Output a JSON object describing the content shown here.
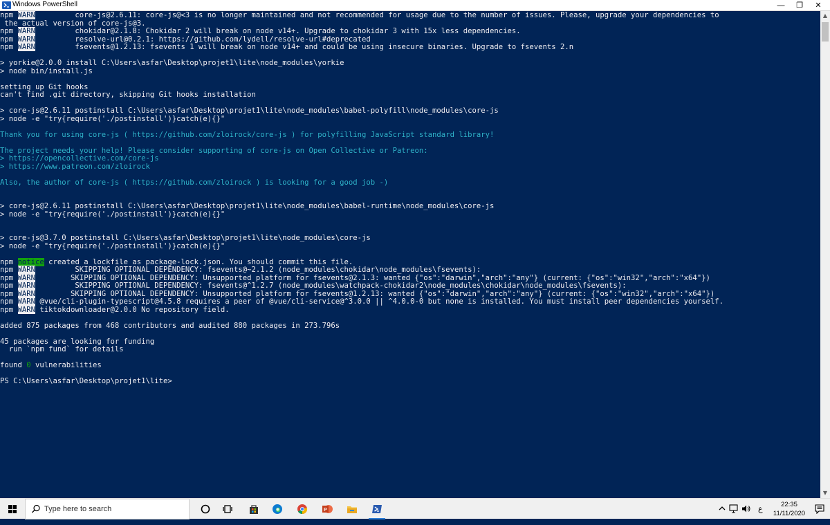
{
  "window": {
    "title": "Windows PowerShell",
    "minimize_glyph": "—",
    "restore_glyph": "❐",
    "close_glyph": "✕"
  },
  "console_lines": [
    {
      "segs": [
        {
          "t": "npm ",
          "c": "white"
        },
        {
          "t": "WARN",
          "c": "warn"
        },
        {
          "t": "         core-js@2.6.11: core-js@<3 is no longer maintained and not recommended for usage due to the number of issues. Please, upgrade your dependencies to",
          "c": "white"
        }
      ]
    },
    {
      "segs": [
        {
          "t": " the actual version of core-js@3.",
          "c": "white"
        }
      ]
    },
    {
      "segs": [
        {
          "t": "npm ",
          "c": "white"
        },
        {
          "t": "WARN",
          "c": "warn"
        },
        {
          "t": "         chokidar@2.1.8: Chokidar 2 will break on node v14+. Upgrade to chokidar 3 with 15x less dependencies.",
          "c": "white"
        }
      ]
    },
    {
      "segs": [
        {
          "t": "npm ",
          "c": "white"
        },
        {
          "t": "WARN",
          "c": "warn"
        },
        {
          "t": "         resolve-url@0.2.1: https://github.com/lydell/resolve-url#deprecated",
          "c": "white"
        }
      ]
    },
    {
      "segs": [
        {
          "t": "npm ",
          "c": "white"
        },
        {
          "t": "WARN",
          "c": "warn"
        },
        {
          "t": "         fsevents@1.2.13: fsevents 1 will break on node v14+ and could be using insecure binaries. Upgrade to fsevents 2.n",
          "c": "white"
        }
      ]
    },
    {
      "segs": []
    },
    {
      "segs": [
        {
          "t": "> yorkie@2.0.0 install C:\\Users\\asfar\\Desktop\\projet1\\lite\\node_modules\\yorkie",
          "c": "white"
        }
      ]
    },
    {
      "segs": [
        {
          "t": "> node bin/install.js",
          "c": "white"
        }
      ]
    },
    {
      "segs": []
    },
    {
      "segs": [
        {
          "t": "setting up Git hooks",
          "c": "white"
        }
      ]
    },
    {
      "segs": [
        {
          "t": "can't find .git directory, skipping Git hooks installation",
          "c": "white"
        }
      ]
    },
    {
      "segs": []
    },
    {
      "segs": [
        {
          "t": "> core-js@2.6.11 postinstall C:\\Users\\asfar\\Desktop\\projet1\\lite\\node_modules\\babel-polyfill\\node_modules\\core-js",
          "c": "white"
        }
      ]
    },
    {
      "segs": [
        {
          "t": "> node -e \"try{require('./postinstall')}catch(e){}\"",
          "c": "white"
        }
      ]
    },
    {
      "segs": []
    },
    {
      "segs": [
        {
          "t": "Thank you for using core-js ( ",
          "c": "cyan"
        },
        {
          "t": "https://github.com/zloirock/core-js",
          "c": "cyan"
        },
        {
          "t": " ) for polyfilling JavaScript standard library!",
          "c": "cyan"
        }
      ]
    },
    {
      "segs": []
    },
    {
      "segs": [
        {
          "t": "The project needs your help! Please consider supporting of core-js on Open Collective or Patreon:",
          "c": "cyan"
        }
      ]
    },
    {
      "segs": [
        {
          "t": "> ",
          "c": "cyan"
        },
        {
          "t": "https://opencollective.com/core-js",
          "c": "cyan"
        }
      ]
    },
    {
      "segs": [
        {
          "t": "> ",
          "c": "cyan"
        },
        {
          "t": "https://www.patreon.com/zloirock",
          "c": "cyan"
        }
      ]
    },
    {
      "segs": []
    },
    {
      "segs": [
        {
          "t": "Also, the author of core-js ( ",
          "c": "cyan"
        },
        {
          "t": "https://github.com/zloirock",
          "c": "cyan"
        },
        {
          "t": " ) is looking for a good job -)",
          "c": "cyan"
        }
      ]
    },
    {
      "segs": []
    },
    {
      "segs": []
    },
    {
      "segs": [
        {
          "t": "> core-js@2.6.11 postinstall C:\\Users\\asfar\\Desktop\\projet1\\lite\\node_modules\\babel-runtime\\node_modules\\core-js",
          "c": "white"
        }
      ]
    },
    {
      "segs": [
        {
          "t": "> node -e \"try{require('./postinstall')}catch(e){}\"",
          "c": "white"
        }
      ]
    },
    {
      "segs": []
    },
    {
      "segs": []
    },
    {
      "segs": [
        {
          "t": "> core-js@3.7.0 postinstall C:\\Users\\asfar\\Desktop\\projet1\\lite\\node_modules\\core-js",
          "c": "white"
        }
      ]
    },
    {
      "segs": [
        {
          "t": "> node -e \"try{require('./postinstall')}catch(e){}\"",
          "c": "white"
        }
      ]
    },
    {
      "segs": []
    },
    {
      "segs": [
        {
          "t": "npm ",
          "c": "white"
        },
        {
          "t": "notice",
          "c": "notice"
        },
        {
          "t": " created a lockfile as package-lock.json. You should commit this file.",
          "c": "white"
        }
      ]
    },
    {
      "segs": [
        {
          "t": "npm ",
          "c": "white"
        },
        {
          "t": "WARN",
          "c": "warn"
        },
        {
          "t": "         SKIPPING OPTIONAL DEPENDENCY: fsevents@~2.1.2 (node_modules\\chokidar\\node_modules\\fsevents):",
          "c": "white"
        }
      ]
    },
    {
      "segs": [
        {
          "t": "npm ",
          "c": "white"
        },
        {
          "t": "WARN",
          "c": "warn"
        },
        {
          "t": "        SKIPPING OPTIONAL DEPENDENCY: Unsupported platform for fsevents@2.1.3: wanted {\"os\":\"darwin\",\"arch\":\"any\"} (current: {\"os\":\"win32\",\"arch\":\"x64\"})",
          "c": "white"
        }
      ]
    },
    {
      "segs": [
        {
          "t": "npm ",
          "c": "white"
        },
        {
          "t": "WARN",
          "c": "warn"
        },
        {
          "t": "         SKIPPING OPTIONAL DEPENDENCY: fsevents@^1.2.7 (node_modules\\watchpack-chokidar2\\node_modules\\chokidar\\node_modules\\fsevents):",
          "c": "white"
        }
      ]
    },
    {
      "segs": [
        {
          "t": "npm ",
          "c": "white"
        },
        {
          "t": "WARN",
          "c": "warn"
        },
        {
          "t": "        SKIPPING OPTIONAL DEPENDENCY: Unsupported platform for fsevents@1.2.13: wanted {\"os\":\"darwin\",\"arch\":\"any\"} (current: {\"os\":\"win32\",\"arch\":\"x64\"})",
          "c": "white"
        }
      ]
    },
    {
      "segs": [
        {
          "t": "npm ",
          "c": "white"
        },
        {
          "t": "WARN",
          "c": "warn"
        },
        {
          "t": " @vue/cli-plugin-typescript@4.5.8 requires a peer of @vue/cli-service@^3.0.0 || ^4.0.0-0 but none is installed. You must install peer dependencies yourself.",
          "c": "white"
        }
      ]
    },
    {
      "segs": [
        {
          "t": "npm ",
          "c": "white"
        },
        {
          "t": "WARN",
          "c": "warn"
        },
        {
          "t": " tiktokdownloader@2.0.0 No repository field.",
          "c": "white"
        }
      ]
    },
    {
      "segs": []
    },
    {
      "segs": [
        {
          "t": "added 875 packages from 468 contributors and audited 880 packages in 273.796s",
          "c": "white"
        }
      ]
    },
    {
      "segs": []
    },
    {
      "segs": [
        {
          "t": "45 packages are looking for funding",
          "c": "white"
        }
      ]
    },
    {
      "segs": [
        {
          "t": "  run `npm fund` for details",
          "c": "white"
        }
      ]
    },
    {
      "segs": []
    },
    {
      "segs": [
        {
          "t": "found ",
          "c": "white"
        },
        {
          "t": "0",
          "c": "green"
        },
        {
          "t": " vulnerabilities",
          "c": "white"
        }
      ]
    },
    {
      "segs": []
    },
    {
      "segs": [
        {
          "t": "PS C:\\Users\\asfar\\Desktop\\projet1\\lite>",
          "c": "white"
        }
      ]
    }
  ],
  "taskbar": {
    "search_placeholder": "Type here to search",
    "apps": [
      {
        "name": "cortana-icon"
      },
      {
        "name": "task-view-icon"
      },
      {
        "name": "store-icon"
      },
      {
        "name": "edge-icon"
      },
      {
        "name": "chrome-icon"
      },
      {
        "name": "powerpoint-icon"
      },
      {
        "name": "file-explorer-icon"
      },
      {
        "name": "powershell-taskbar-icon"
      }
    ],
    "tray": {
      "language": "ع",
      "time": "22:35",
      "date": "11/11/2020"
    }
  },
  "colors": {
    "console_bg": "#012456",
    "console_fg": "#eeedf0",
    "cyan": "#2fb2c8",
    "green": "#13a10e"
  }
}
